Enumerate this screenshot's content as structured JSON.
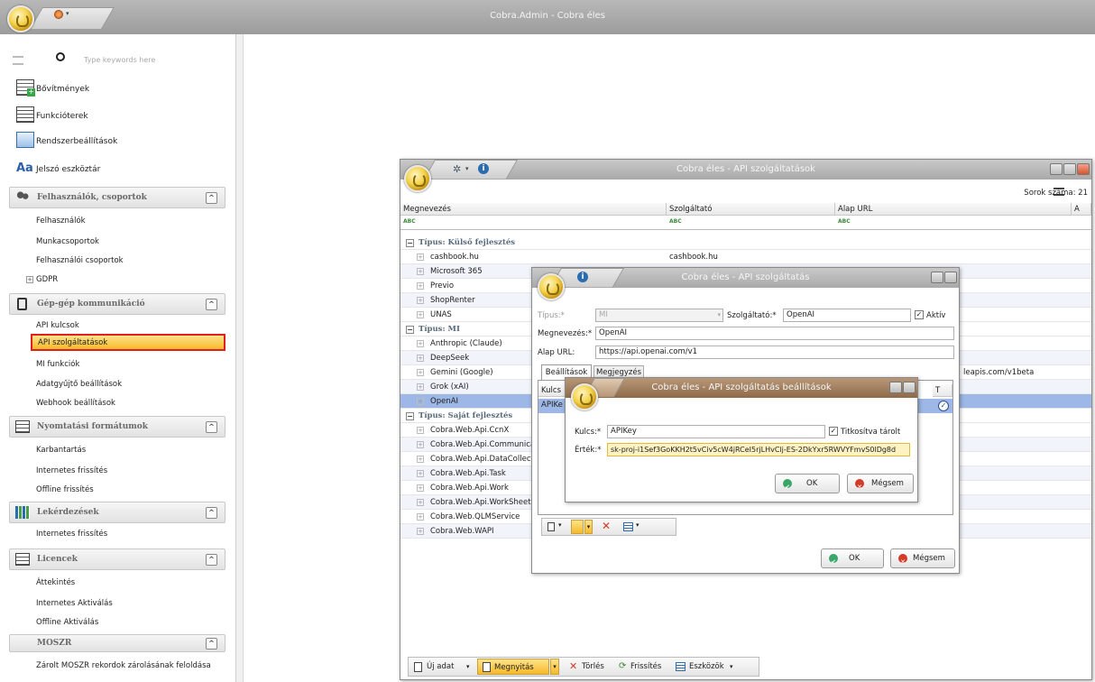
{
  "app": {
    "title": "Cobra.Admin - Cobra éles"
  },
  "sidebar": {
    "search_placeholder": "Type keywords here",
    "top_items": [
      {
        "label": "Bővítmények",
        "icon": "extensions-icon"
      },
      {
        "label": "Funkcióterek",
        "icon": "function-spaces-icon"
      },
      {
        "label": "Rendszerbeállítások",
        "icon": "system-settings-icon"
      },
      {
        "label": "Jelszó eszköztár",
        "icon": "password-tools-icon",
        "glyph": "Aa"
      }
    ],
    "groups": [
      {
        "label": "Felhasználók, csoportok",
        "items": [
          "Felhasználók",
          "Munkacsoportok",
          "Felhasználói csoportok",
          "GDPR"
        ]
      },
      {
        "label": "Gép-gép kommunikáció",
        "items": [
          "API kulcsok",
          "API szolgáltatások",
          "MI funkciók",
          "Adatgyűjtő beállítások",
          "Webhook beállítások"
        ]
      },
      {
        "label": "Nyomtatási formátumok",
        "items": [
          "Karbantartás",
          "Internetes frissítés",
          "Offline frissítés"
        ]
      },
      {
        "label": "Lekérdezések",
        "items": [
          "Internetes frissítés"
        ]
      },
      {
        "label": "Licencek",
        "items": [
          "Áttekintés",
          "Internetes Aktiválás",
          "Offline Aktiválás"
        ]
      },
      {
        "label": "MOSZR",
        "items": [
          "Zárolt MOSZR rekordok zárolásának feloldása"
        ]
      }
    ],
    "selected": "API szolgáltatások"
  },
  "services_window": {
    "title": "Cobra éles - API szolgáltatások",
    "row_count": "Sorok száma: 21",
    "columns": [
      "Megnevezés",
      "Szolgáltató",
      "Alap URL",
      "A"
    ],
    "filter_glyph": "ABC",
    "groups": [
      {
        "label": "Típus: Külső fejlesztés",
        "rows": [
          {
            "name": "cashbook.hu",
            "provider": "cashbook.hu",
            "url": ""
          },
          {
            "name": "Microsoft 365",
            "provider": "",
            "url": ""
          },
          {
            "name": "Previo",
            "provider": "",
            "url": ""
          },
          {
            "name": "ShopRenter",
            "provider": "",
            "url": ""
          },
          {
            "name": "UNAS",
            "provider": "",
            "url": ""
          }
        ]
      },
      {
        "label": "Típus: MI",
        "rows": [
          {
            "name": "Anthropic (Claude)",
            "provider": "",
            "url": ""
          },
          {
            "name": "DeepSeek",
            "provider": "",
            "url": ""
          },
          {
            "name": "Gemini (Google)",
            "provider": "",
            "url": "leapis.com/v1beta"
          },
          {
            "name": "Grok (xAI)",
            "provider": "",
            "url": ""
          },
          {
            "name": "OpenAI",
            "provider": "",
            "url": ""
          }
        ]
      },
      {
        "label": "Típus: Saját fejlesztés",
        "rows": [
          {
            "name": "Cobra.Web.Api.CcnX",
            "provider": "",
            "url": ""
          },
          {
            "name": "Cobra.Web.Api.Communica",
            "provider": "",
            "url": ""
          },
          {
            "name": "Cobra.Web.Api.DataCollect",
            "provider": "",
            "url": ""
          },
          {
            "name": "Cobra.Web.Api.Task",
            "provider": "",
            "url": ""
          },
          {
            "name": "Cobra.Web.Api.Work",
            "provider": "",
            "url": ""
          },
          {
            "name": "Cobra.Web.Api.WorkSheet",
            "provider": "",
            "url": ""
          },
          {
            "name": "Cobra.Web.QLMService",
            "provider": "",
            "url": ""
          },
          {
            "name": "Cobra.Web.WAPI",
            "provider": "",
            "url": ""
          }
        ]
      }
    ],
    "toolbar": {
      "new": "Új adat",
      "open": "Megnyitás",
      "delete": "Törlés",
      "refresh": "Frissítés",
      "tools": "Eszközök"
    }
  },
  "service_dialog": {
    "title": "Cobra éles - API szolgáltatás",
    "type_label": "Típus:*",
    "type_value": "MI",
    "provider_label": "Szolgáltató:*",
    "provider_value": "OpenAI",
    "active_label": "Aktív",
    "name_label": "Megnevezés:*",
    "name_value": "OpenAI",
    "url_label": "Alap URL:",
    "url_value": "https://api.openai.com/v1",
    "tabs": [
      "Beállítások",
      "Megjegyzés"
    ],
    "grid_headers": [
      "Kulcs",
      "T"
    ],
    "grid_row": "APIKe",
    "ok": "OK",
    "cancel": "Mégsem"
  },
  "settings_dialog": {
    "title": "Cobra éles - API szolgáltatás beállítások",
    "key_label": "Kulcs:*",
    "key_value": "APIKey",
    "encrypted_label": "Titkosítva tárolt",
    "value_label": "Érték:*",
    "value_value": "sk-proj-i1Sef3GoKKH2t5vCiv5cW4jRCeI5rjLHvClj-ES-2DkYxr5RWVYFmvS0lDg8d",
    "ok": "OK",
    "cancel": "Mégsem"
  },
  "colors": {
    "selected_item": "#f9c846",
    "selected_border": "#e02020",
    "grid_selected": "#9db7e6"
  }
}
